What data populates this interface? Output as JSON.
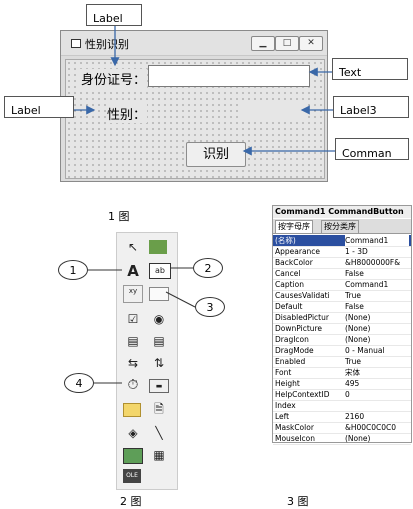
{
  "figure1": {
    "window_title": "性别识别",
    "controls": {
      "id_label": "身份证号：",
      "gender_label": "性别：",
      "command_caption": "识别"
    },
    "callouts": {
      "label_top": "Label",
      "text": "Text",
      "label_left": "Label",
      "label3": "Label3",
      "command": "Comman"
    },
    "caption": "1 图"
  },
  "figure2": {
    "callouts": [
      "1",
      "2",
      "3",
      "4"
    ],
    "caption": "2 图"
  },
  "figure3": {
    "header": "Command1 CommandButton",
    "tabs": [
      "按字母序",
      "按分类序"
    ],
    "properties": [
      {
        "name": "(名称)",
        "value": "Command1"
      },
      {
        "name": "Appearance",
        "value": "1 - 3D"
      },
      {
        "name": "BackColor",
        "value": "&H8000000F&"
      },
      {
        "name": "Cancel",
        "value": "False"
      },
      {
        "name": "Caption",
        "value": "Command1"
      },
      {
        "name": "CausesValidati",
        "value": "True"
      },
      {
        "name": "Default",
        "value": "False"
      },
      {
        "name": "DisabledPictur",
        "value": "(None)"
      },
      {
        "name": "DownPicture",
        "value": "(None)"
      },
      {
        "name": "DragIcon",
        "value": "(None)"
      },
      {
        "name": "DragMode",
        "value": "0 - Manual"
      },
      {
        "name": "Enabled",
        "value": "True"
      },
      {
        "name": "Font",
        "value": "宋体"
      },
      {
        "name": "Height",
        "value": "495"
      },
      {
        "name": "HelpContextID",
        "value": "0"
      },
      {
        "name": "Index",
        "value": ""
      },
      {
        "name": "Left",
        "value": "2160"
      },
      {
        "name": "MaskColor",
        "value": "&H00C0C0C0"
      },
      {
        "name": "MouseIcon",
        "value": "(None)"
      }
    ],
    "caption": "3 图"
  }
}
